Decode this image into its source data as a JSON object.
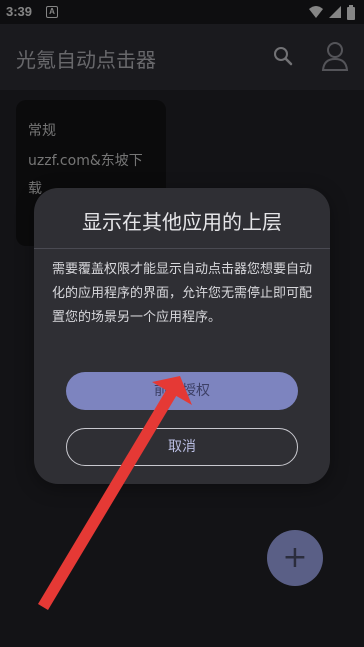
{
  "status_bar": {
    "time": "3:39",
    "notification_badge": "A",
    "icons": [
      "wifi-icon",
      "signal-icon",
      "battery-icon"
    ]
  },
  "app_bar": {
    "title": "光氪自动点击器",
    "icons": [
      "search-icon",
      "user-icon"
    ]
  },
  "card": {
    "title": "常规",
    "text": "uzzf.com&东坡下载"
  },
  "dialog": {
    "title": "显示在其他应用的上层",
    "message": "需要覆盖权限才能显示自动点击器您想要自动化的应用程序的界面，允许您无需停止即可配置您的场景另一个应用程序。",
    "primary_button": "前往授权",
    "secondary_button": "取消"
  },
  "fab": {
    "label": "+"
  },
  "annotation": {
    "shape": "red-arrow-icon",
    "color": "#e53935"
  },
  "colors": {
    "primary_button": "#7d84bf",
    "dialog_background": "#2f2f34",
    "app_background": "#232328",
    "fab": "#5a5f86"
  }
}
